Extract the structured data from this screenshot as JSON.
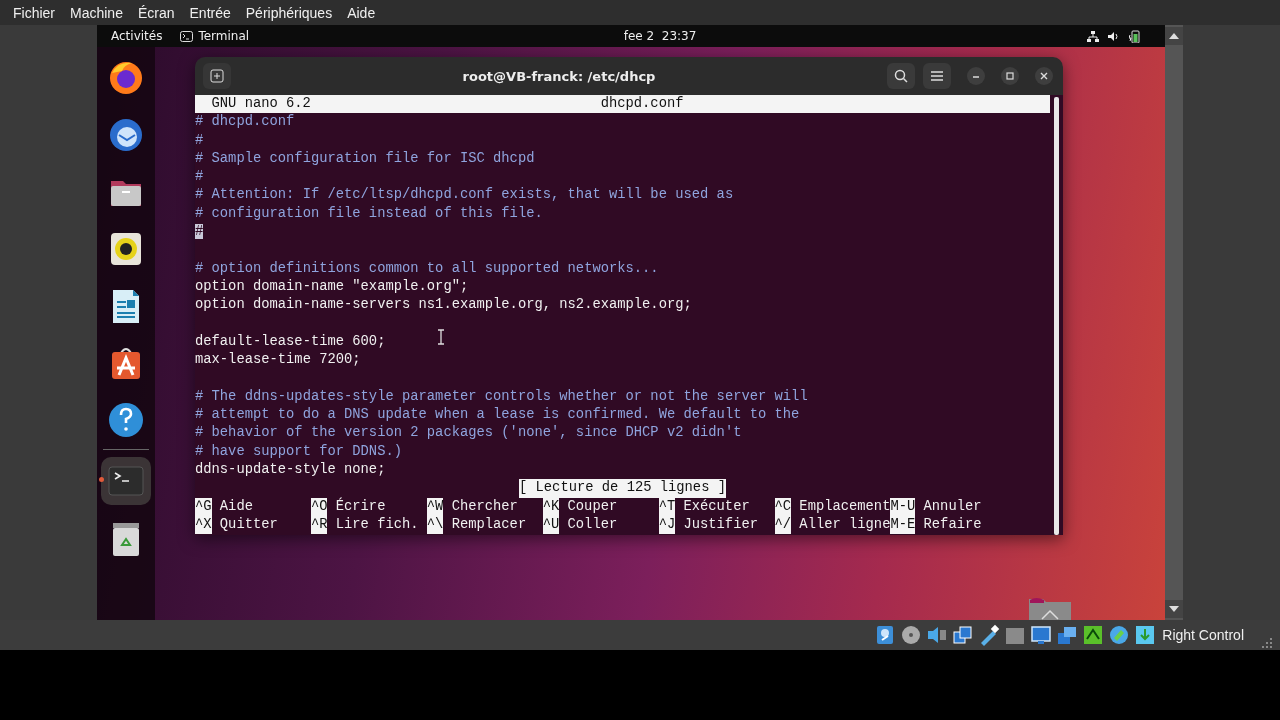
{
  "host_menu": [
    "Fichier",
    "Machine",
    "Écran",
    "Entrée",
    "Périphériques",
    "Aide"
  ],
  "topbar": {
    "activities": "Activités",
    "app": "Terminal",
    "clock": "fee 2  23:37"
  },
  "dock": [
    {
      "kind": "browser",
      "selected": false
    },
    {
      "kind": "mail",
      "selected": false
    },
    {
      "kind": "files",
      "selected": false
    },
    {
      "kind": "music",
      "selected": false
    },
    {
      "kind": "writer",
      "selected": false
    },
    {
      "kind": "store",
      "selected": false
    },
    {
      "kind": "help",
      "selected": false
    },
    {
      "kind": "terminal",
      "selected": true
    },
    {
      "kind": "trash",
      "selected": false
    }
  ],
  "terminal": {
    "title": "root@VB-franck: /etc/dhcp",
    "nano": {
      "version": "GNU nano 6.2",
      "filename": "dhcpd.conf",
      "lines": [
        {
          "kind": "comment",
          "text": "# dhcpd.conf",
          "cursor": false
        },
        {
          "kind": "comment",
          "text": "#",
          "cursor": false
        },
        {
          "kind": "comment",
          "text": "# Sample configuration file for ISC dhcpd",
          "cursor": false
        },
        {
          "kind": "comment",
          "text": "#",
          "cursor": false
        },
        {
          "kind": "comment",
          "text": "# Attention: If /etc/ltsp/dhcpd.conf exists, that will be used as",
          "cursor": false
        },
        {
          "kind": "comment",
          "text": "# configuration file instead of this file.",
          "cursor": false
        },
        {
          "kind": "comment",
          "text": "#",
          "cursor": true
        },
        {
          "kind": "blank",
          "cursor": false
        },
        {
          "kind": "comment",
          "text": "# option definitions common to all supported networks...",
          "cursor": false
        },
        {
          "kind": "code",
          "text": "option domain-name \"example.org\";",
          "cursor": false
        },
        {
          "kind": "code",
          "text": "option domain-name-servers ns1.example.org, ns2.example.org;",
          "cursor": false
        },
        {
          "kind": "blank",
          "cursor": false
        },
        {
          "kind": "code",
          "text": "default-lease-time 600;",
          "cursor": false
        },
        {
          "kind": "code",
          "text": "max-lease-time 7200;",
          "cursor": false
        },
        {
          "kind": "blank",
          "cursor": false
        },
        {
          "kind": "comment",
          "text": "# The ddns-updates-style parameter controls whether or not the server will",
          "cursor": false
        },
        {
          "kind": "comment",
          "text": "# attempt to do a DNS update when a lease is confirmed. We default to the",
          "cursor": false
        },
        {
          "kind": "comment",
          "text": "# behavior of the version 2 packages ('none', since DHCP v2 didn't",
          "cursor": false
        },
        {
          "kind": "comment",
          "text": "# have support for DDNS.)",
          "cursor": false
        },
        {
          "kind": "code",
          "text": "ddns-update-style none;",
          "cursor": false
        }
      ],
      "status": "[ Lecture de 125 lignes ]",
      "shortcuts": [
        [
          {
            "key": "^G",
            "label": "Aide"
          },
          {
            "key": "^O",
            "label": "Écrire"
          },
          {
            "key": "^W",
            "label": "Chercher"
          },
          {
            "key": "^K",
            "label": "Couper"
          },
          {
            "key": "^T",
            "label": "Exécuter"
          },
          {
            "key": "^C",
            "label": "Emplacement"
          },
          {
            "key": "M-U",
            "label": "Annuler"
          }
        ],
        [
          {
            "key": "^X",
            "label": "Quitter"
          },
          {
            "key": "^R",
            "label": "Lire fich."
          },
          {
            "key": "^\\",
            "label": "Remplacer"
          },
          {
            "key": "^U",
            "label": "Coller"
          },
          {
            "key": "^J",
            "label": "Justifier"
          },
          {
            "key": "^/",
            "label": "Aller ligne"
          },
          {
            "key": "M-E",
            "label": "Refaire"
          }
        ]
      ]
    }
  },
  "status_bar": {
    "host_key": "Right Control"
  }
}
